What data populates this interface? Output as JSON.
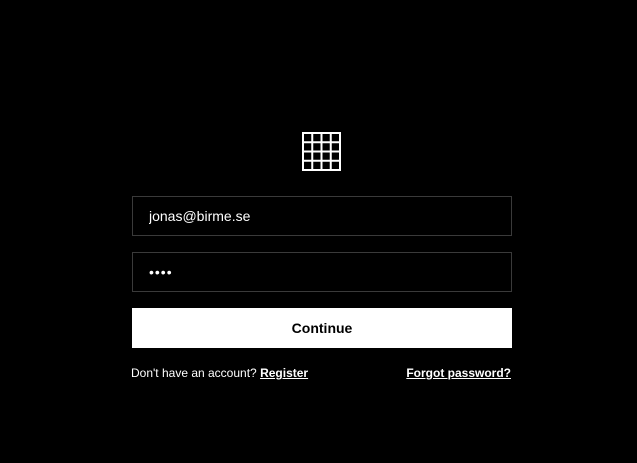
{
  "logo": {
    "icon": "grid-logo-icon",
    "color": "#ffffff"
  },
  "form": {
    "email_value": "jonas@birme.se",
    "password_value": "1234",
    "continue_label": "Continue"
  },
  "footer": {
    "no_account_text": "Don't have an account?",
    "register_label": "Register",
    "forgot_label": "Forgot password?"
  },
  "colors": {
    "background": "#000000",
    "foreground": "#ffffff",
    "field_border": "#3a3a3a"
  }
}
